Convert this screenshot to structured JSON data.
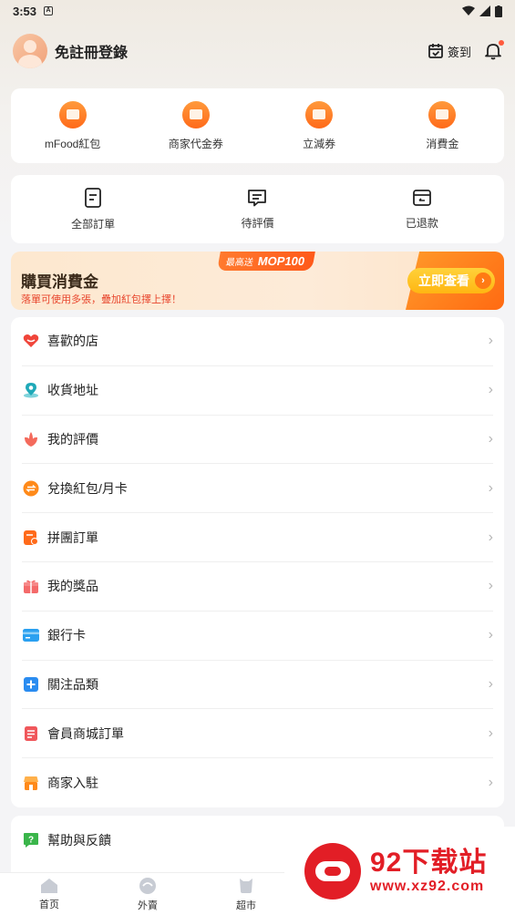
{
  "status_bar": {
    "time": "3:53"
  },
  "header": {
    "login_label": "免註冊登錄",
    "checkin_label": "簽到"
  },
  "quick_actions": [
    {
      "label": "mFood紅包",
      "icon": "coin-icon"
    },
    {
      "label": "商家代金券",
      "icon": "ticket-icon"
    },
    {
      "label": "立減券",
      "icon": "wallet-icon"
    },
    {
      "label": "消費金",
      "icon": "card-icon"
    }
  ],
  "orders": [
    {
      "label": "全部訂單",
      "icon": "list-icon"
    },
    {
      "label": "待評價",
      "icon": "comment-icon"
    },
    {
      "label": "已退款",
      "icon": "refund-icon"
    }
  ],
  "banner": {
    "title": "購買消費金",
    "subtitle": "落單可使用多張，疊加紅包擇上擇！",
    "promo_prefix": "最高送",
    "promo_value": "MOP100",
    "cta": "立即查看"
  },
  "menu": [
    {
      "label": "喜歡的店",
      "icon": "heart-icon",
      "color": "#f0453a"
    },
    {
      "label": "收貨地址",
      "icon": "location-icon",
      "color": "#1fa9b8"
    },
    {
      "label": "我的評價",
      "icon": "flower-icon",
      "color": "#f46a5c"
    },
    {
      "label": "兌換紅包/月卡",
      "icon": "exchange-icon",
      "color": "#ff8a1a"
    },
    {
      "label": "拼團訂單",
      "icon": "group-order-icon",
      "color": "#ff6a1a"
    },
    {
      "label": "我的獎品",
      "icon": "gift-icon",
      "color": "#f46a6a"
    },
    {
      "label": "銀行卡",
      "icon": "bank-card-icon",
      "color": "#2aa0f0"
    },
    {
      "label": "關注品類",
      "icon": "plus-square-icon",
      "color": "#2a8cf0"
    },
    {
      "label": "會員商城訂單",
      "icon": "document-icon",
      "color": "#f0575b"
    },
    {
      "label": "商家入駐",
      "icon": "store-icon",
      "color": "#ff8a1a"
    }
  ],
  "help": {
    "label": "幫助與反饋",
    "icon": "help-icon",
    "color": "#3ab54a"
  },
  "tabs": [
    {
      "label": "首页",
      "icon": "home-icon"
    },
    {
      "label": "外賣",
      "icon": "delivery-icon"
    },
    {
      "label": "超市",
      "icon": "market-icon"
    }
  ],
  "watermark": {
    "brand": "92下载站",
    "url": "www.xz92.com"
  }
}
